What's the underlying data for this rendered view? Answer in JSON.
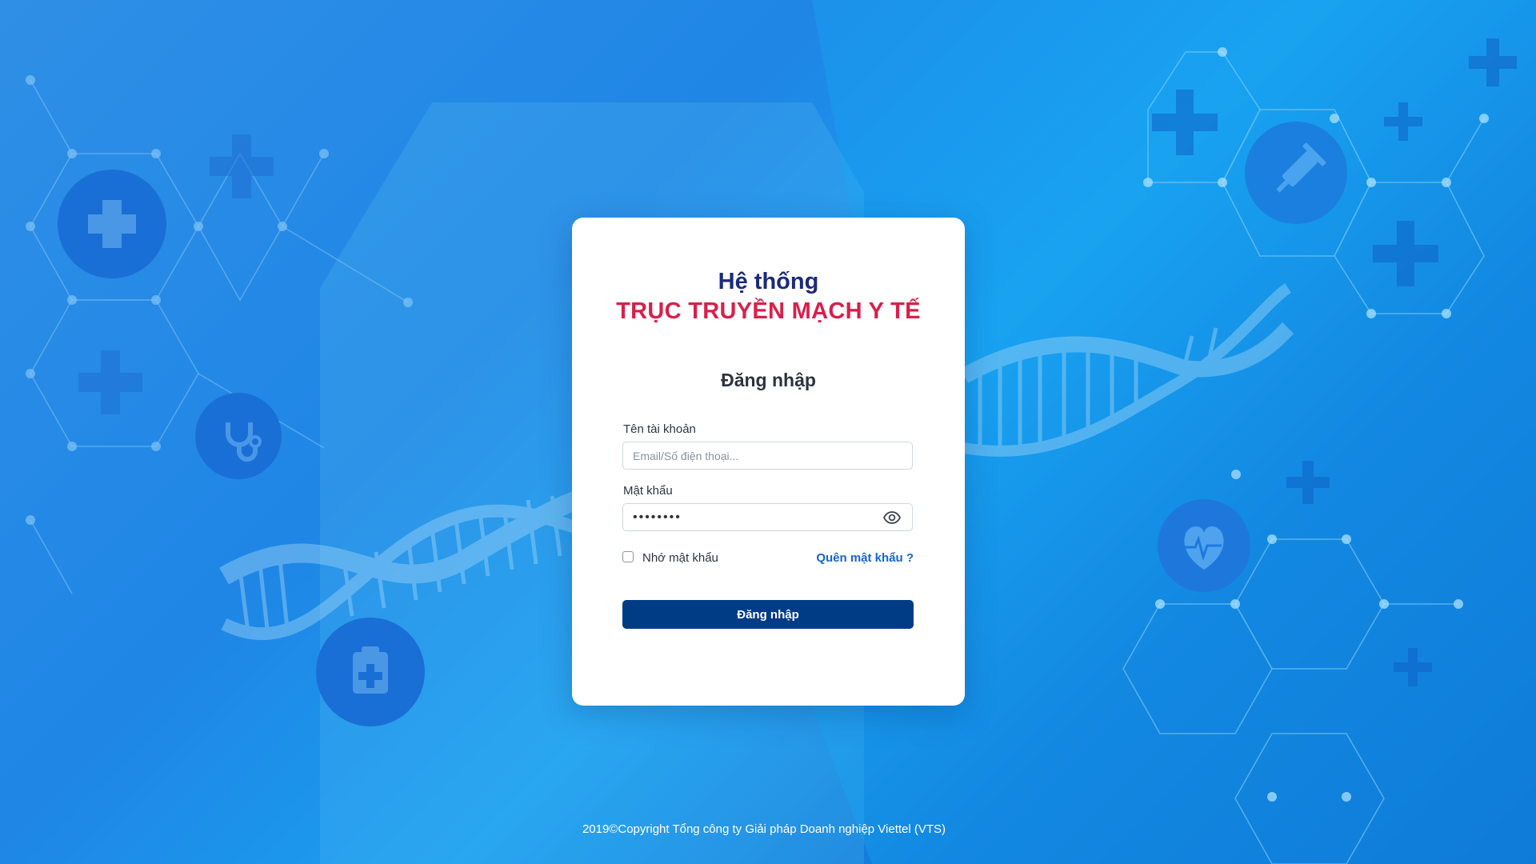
{
  "app": {
    "title_line1": "Hệ thống",
    "title_line2": "TRỤC TRUYỀN MẠCH Y TẾ"
  },
  "login": {
    "heading": "Đăng nhập",
    "username_label": "Tên tài khoản",
    "username_placeholder": "Email/Số điện thoại...",
    "username_value": "",
    "password_label": "Mật khẩu",
    "password_value": "••••••••",
    "remember_label": "Nhớ mật khẩu",
    "remember_checked": false,
    "forgot_label": "Quên mật khẩu ?",
    "submit_label": "Đăng nhập"
  },
  "footer": {
    "copyright": "2019©Copyright Tổng công ty Giải pháp Doanh nghiệp Viettel (VTS)"
  },
  "icons": {
    "password_toggle": "eye-icon",
    "background": [
      "medical-cross-icon",
      "stethoscope-icon",
      "clipboard-icon",
      "syringe-icon",
      "heart-pulse-icon",
      "dna-helix-icon"
    ]
  },
  "colors": {
    "title_primary": "#1b2a7a",
    "title_accent": "#d8204a",
    "button": "#003c85",
    "link": "#1466c9",
    "background_start": "#2f8fe6",
    "background_end": "#0a63c9"
  }
}
